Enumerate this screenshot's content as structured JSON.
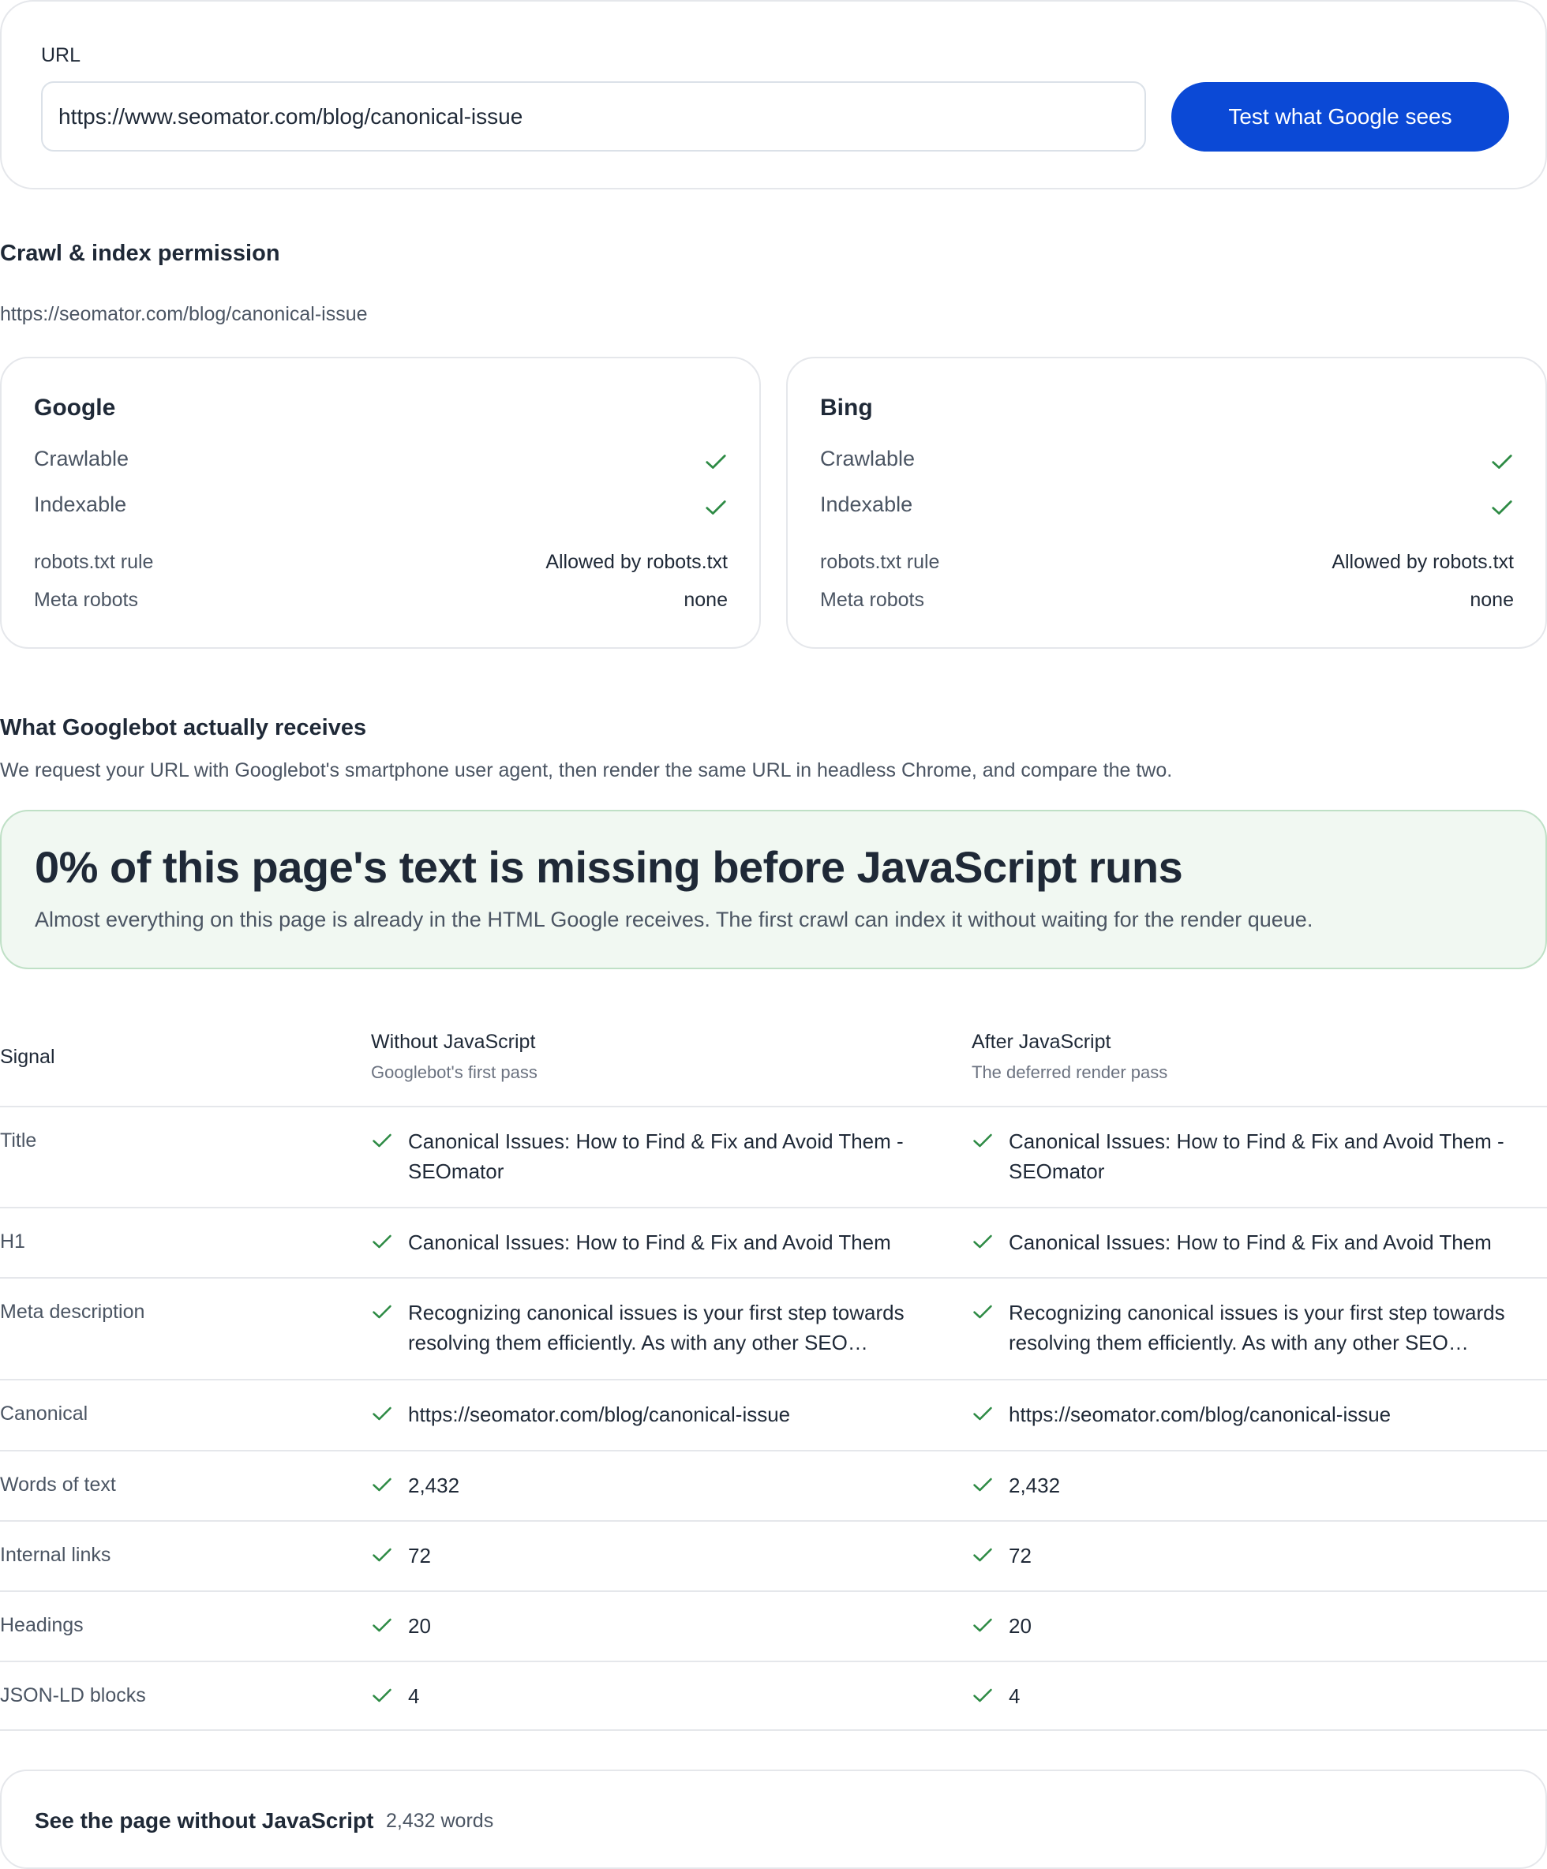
{
  "form": {
    "url_label": "URL",
    "url_value": "https://www.seomator.com/blog/canonical-issue",
    "submit_label": "Test what Google sees"
  },
  "crawl": {
    "heading": "Crawl & index permission",
    "checked_url": "https://seomator.com/blog/canonical-issue",
    "engines": [
      {
        "name": "Google",
        "crawlable_label": "Crawlable",
        "indexable_label": "Indexable",
        "robots_label": "robots.txt rule",
        "robots_value": "Allowed by robots.txt",
        "meta_label": "Meta robots",
        "meta_value": "none"
      },
      {
        "name": "Bing",
        "crawlable_label": "Crawlable",
        "indexable_label": "Indexable",
        "robots_label": "robots.txt rule",
        "robots_value": "Allowed by robots.txt",
        "meta_label": "Meta robots",
        "meta_value": "none"
      }
    ]
  },
  "googlebot": {
    "heading": "What Googlebot actually receives",
    "description": "We request your URL with Googlebot's smartphone user agent, then render the same URL in headless Chrome, and compare the two.",
    "verdict_title": "0% of this page's text is missing before JavaScript runs",
    "verdict_desc": "Almost everything on this page is already in the HTML Google receives. The first crawl can index it without waiting for the render queue."
  },
  "table": {
    "col_signal": "Signal",
    "col_without": "Without JavaScript",
    "col_without_sub": "Googlebot's first pass",
    "col_after": "After JavaScript",
    "col_after_sub": "The deferred render pass",
    "rows": [
      {
        "signal": "Title",
        "without": "Canonical Issues: How to Find & Fix and Avoid Them - SEOmator",
        "after": "Canonical Issues: How to Find & Fix and Avoid Them - SEOmator"
      },
      {
        "signal": "H1",
        "without": "Canonical Issues: How to Find & Fix and Avoid Them",
        "after": "Canonical Issues: How to Find & Fix and Avoid Them"
      },
      {
        "signal": "Meta description",
        "without": "Recognizing canonical issues is your first step towards resolving them efficiently. As with any other SEO…",
        "after": "Recognizing canonical issues is your first step towards resolving them efficiently. As with any other SEO…"
      },
      {
        "signal": "Canonical",
        "without": "https://seomator.com/blog/canonical-issue",
        "after": "https://seomator.com/blog/canonical-issue"
      },
      {
        "signal": "Words of text",
        "without": "2,432",
        "after": "2,432"
      },
      {
        "signal": "Internal links",
        "without": "72",
        "after": "72"
      },
      {
        "signal": "Headings",
        "without": "20",
        "after": "20"
      },
      {
        "signal": "JSON-LD blocks",
        "without": "4",
        "after": "4"
      }
    ]
  },
  "footer_card": {
    "title": "See the page without JavaScript",
    "count": "2,432 words"
  },
  "colors": {
    "accent": "#0b49d6",
    "success": "#2e8b45",
    "verdict_bg": "#f1f8f2",
    "verdict_border": "#bfe0c6"
  },
  "icons": {
    "check": "check-icon"
  }
}
